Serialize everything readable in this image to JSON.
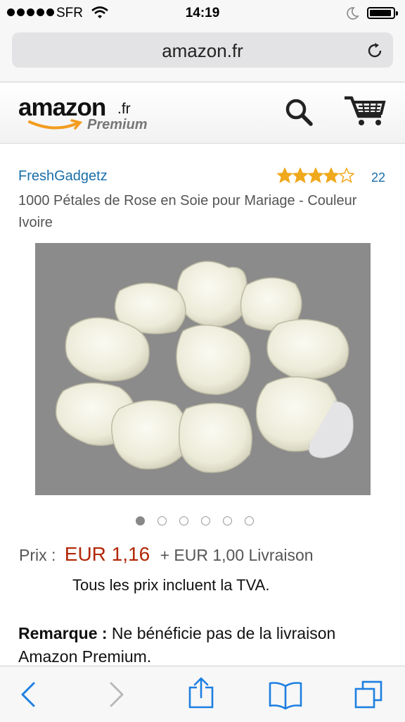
{
  "status_bar": {
    "carrier": "SFR",
    "time": "14:19"
  },
  "browser": {
    "url": "amazon.fr"
  },
  "header": {
    "logo_text": "amazon",
    "logo_suffix": ".fr",
    "logo_premium": "Premium",
    "icons": [
      "search-icon",
      "cart-icon"
    ]
  },
  "product": {
    "seller": "FreshGadgetz",
    "rating_stars": 4,
    "rating_max": 5,
    "rating_count": "22",
    "title": "1000 Pétales de Rose en Soie pour Mariage - Couleur Ivoire",
    "image_count": 6,
    "active_image": 1,
    "price_label": "Prix :",
    "price": "EUR 1,16",
    "shipping": "+ EUR 1,00 Livraison",
    "vat_note": "Tous les prix incluent la TVA.",
    "remark_label": "Remarque :",
    "remark_text": " Ne bénéficie pas de la livraison Amazon Premium."
  },
  "toolbar": {
    "icons": [
      "back-icon",
      "forward-icon",
      "share-icon",
      "bookmarks-icon",
      "tabs-icon"
    ]
  },
  "colors": {
    "price": "#b12704",
    "link": "#1a6fa8",
    "star": "#f0a81c",
    "ios_blue": "#1d7fe2"
  }
}
